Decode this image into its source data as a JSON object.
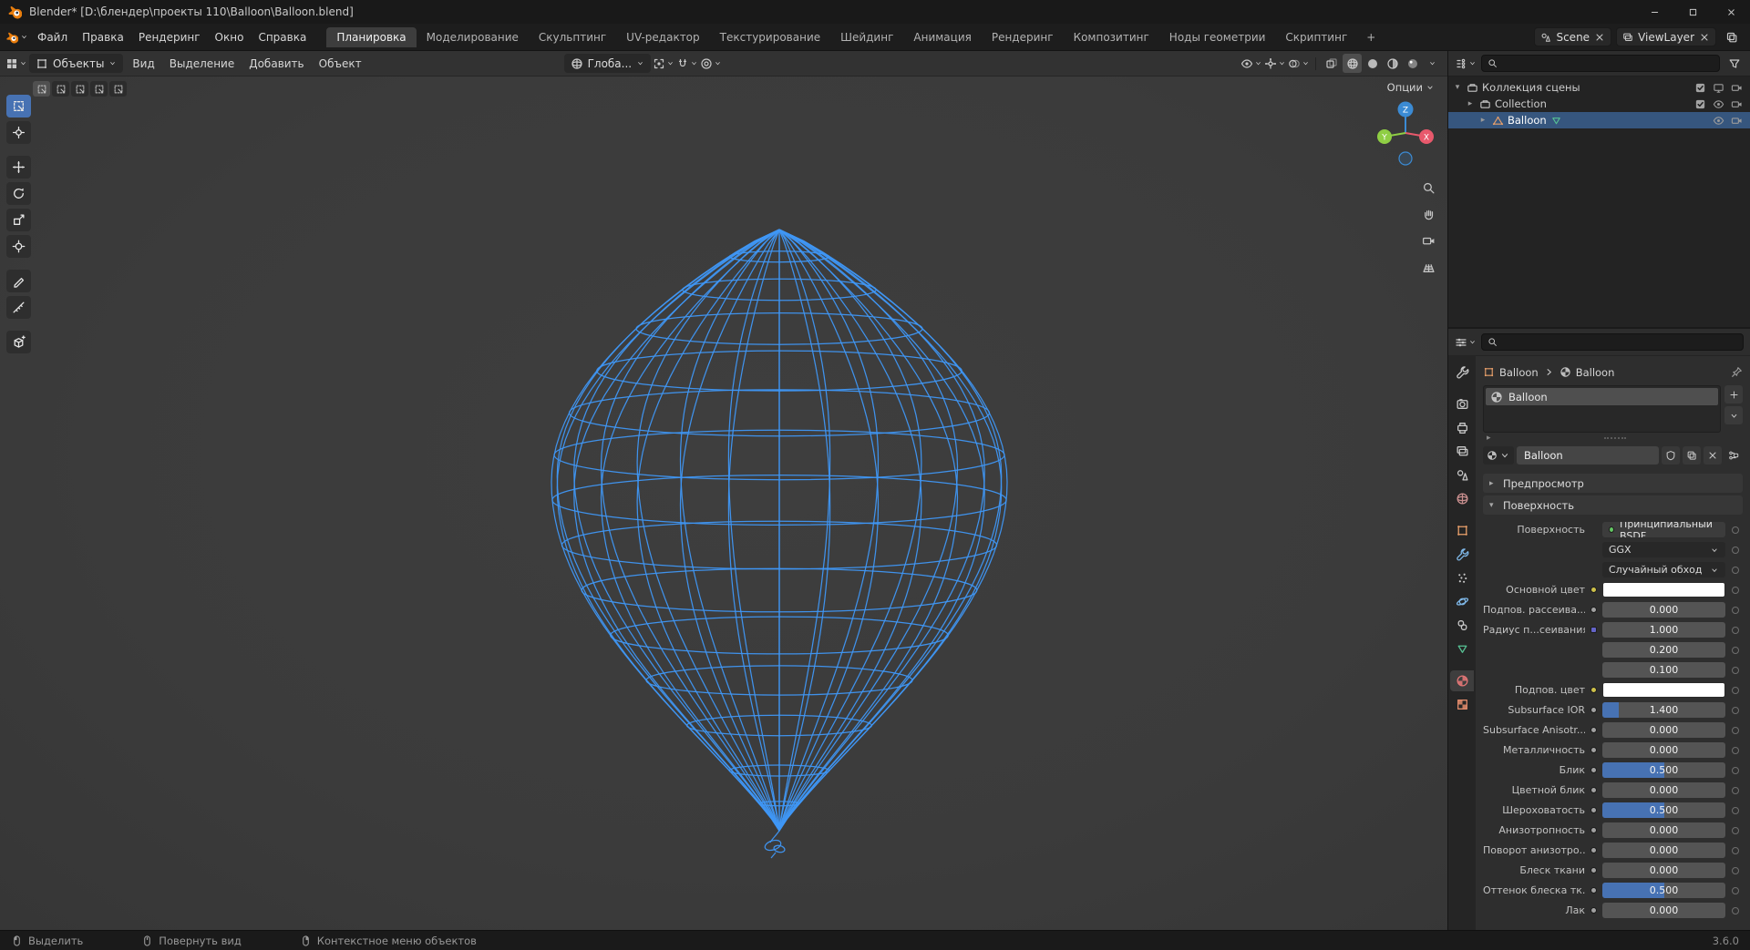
{
  "theme": {
    "accent": "#4772b3",
    "selection": "#36567e",
    "wireframe": "#3f97f5",
    "axis_x": "#e8596c",
    "axis_y": "#8fce44",
    "axis_z": "#3b8bd4",
    "socket_color": "#cdc04a",
    "socket_float": "#a1a1a1",
    "socket_vector": "#6464c8",
    "socket_shader": "#63c763"
  },
  "window": {
    "title": "Blender* [D:\\блендер\\проекты 110\\Balloon\\Balloon.blend]"
  },
  "menubar": {
    "menus": [
      "Файл",
      "Правка",
      "Рендеринг",
      "Окно",
      "Справка"
    ],
    "workspaces": [
      "Планировка",
      "Моделирование",
      "Скульптинг",
      "UV-редактор",
      "Текстурирование",
      "Шейдинг",
      "Анимация",
      "Рендеринг",
      "Композитинг",
      "Ноды геометрии",
      "Скриптинг"
    ],
    "active_workspace": "Планировка",
    "add_workspace_label": "+",
    "scene": {
      "label": "Scene"
    },
    "view_layer": {
      "label": "ViewLayer"
    }
  },
  "viewport_header": {
    "mode": "Объекты",
    "menus": [
      "Вид",
      "Выделение",
      "Добавить",
      "Объект"
    ],
    "orientation": "Глоба..."
  },
  "tool_settings": [
    {
      "id": "set",
      "active": true
    },
    {
      "id": "extend",
      "active": false
    },
    {
      "id": "subtract",
      "active": false
    },
    {
      "id": "invert",
      "active": false
    },
    {
      "id": "intersect",
      "active": false
    }
  ],
  "toolbar": [
    {
      "id": "select-box",
      "icon": "selectbox",
      "active": true
    },
    {
      "id": "cursor",
      "icon": "cursor3d",
      "active": false
    },
    {
      "id": "move",
      "icon": "move",
      "active": false
    },
    {
      "id": "rotate",
      "icon": "rotate",
      "active": false
    },
    {
      "id": "scale",
      "icon": "scale",
      "active": false
    },
    {
      "id": "transform",
      "icon": "transform",
      "active": false
    },
    {
      "id": "annotate",
      "icon": "annotate",
      "active": false
    },
    {
      "id": "measure",
      "icon": "measure",
      "active": false
    },
    {
      "id": "add-cube",
      "icon": "addcube",
      "active": false
    }
  ],
  "viewport": {
    "options_label": "Опции",
    "gizmo_axes": [
      "X",
      "Y",
      "Z"
    ]
  },
  "outliner": {
    "rows": [
      {
        "label": "Коллекция сцены",
        "icon": "collection",
        "indent": 0,
        "expand": "down",
        "selected": false,
        "right": [
          "checkbox",
          "screen",
          "camera"
        ]
      },
      {
        "label": "Collection",
        "icon": "collection",
        "indent": 1,
        "expand": "right",
        "selected": false,
        "right": [
          "checkbox",
          "eye",
          "camera"
        ]
      },
      {
        "label": "Balloon",
        "icon": "meshtri",
        "suffix_icon": "datatriangle",
        "indent": 2,
        "expand": "right",
        "selected": true,
        "right": [
          "eye",
          "camera"
        ]
      }
    ]
  },
  "properties": {
    "breadcrumb": {
      "object": "Balloon",
      "data": "Balloon"
    },
    "tabs": [
      {
        "id": "tool",
        "icon": "wrench",
        "color": "#c9c9c9",
        "active": false
      },
      {
        "id": "render",
        "icon": "render",
        "color": "#c9c9c9",
        "active": false
      },
      {
        "id": "output",
        "icon": "output",
        "color": "#c9c9c9",
        "active": false
      },
      {
        "id": "view-layer",
        "icon": "viewlayer",
        "color": "#c9c9c9",
        "active": false
      },
      {
        "id": "scene",
        "icon": "scene",
        "color": "#c9c9c9",
        "active": false
      },
      {
        "id": "world",
        "icon": "world",
        "color": "#c98f8f",
        "active": false
      },
      {
        "id": "object",
        "icon": "objsq",
        "color": "#e9a06b",
        "active": false
      },
      {
        "id": "modifiers",
        "icon": "wrench",
        "color": "#7fb8e8",
        "active": false
      },
      {
        "id": "particles",
        "icon": "particles",
        "color": "#c9c9c9",
        "active": false
      },
      {
        "id": "physics",
        "icon": "physics",
        "color": "#7fb8e8",
        "active": false
      },
      {
        "id": "constraints",
        "icon": "constraints",
        "color": "#c9c9c9",
        "active": false
      },
      {
        "id": "object-data",
        "icon": "datatriangle",
        "color": "#57c294",
        "active": false
      },
      {
        "id": "material",
        "icon": "matsphere",
        "color": "#e07575",
        "active": true
      },
      {
        "id": "texture",
        "icon": "texchecker",
        "color": "#e08b6b",
        "active": false
      }
    ],
    "slot_name": "Balloon",
    "material_name": "Balloon",
    "preview_section": "Предпросмотр",
    "surface_section": "Поверхность",
    "surface_label": "Поверхность",
    "surface_shader": "Принципиальный BSDF",
    "distribution": "GGX",
    "subsurface_method": "Случайный обход",
    "fields": [
      {
        "label": "Основной цвет",
        "type": "color",
        "socket": "color",
        "value": "#FFFFFF"
      },
      {
        "label": "Подпов. рассеива...",
        "type": "slider",
        "socket": "float",
        "value": "0.000",
        "fill": 0
      },
      {
        "label": "Радиус п...сеивания",
        "type": "value",
        "socket": "vector",
        "value": "1.000"
      },
      {
        "label": "",
        "type": "value",
        "socket": null,
        "value": "0.200"
      },
      {
        "label": "",
        "type": "value",
        "socket": null,
        "value": "0.100"
      },
      {
        "label": "Подпов. цвет",
        "type": "color",
        "socket": "color",
        "value": "#FFFFFF"
      },
      {
        "label": "Subsurface IOR",
        "type": "slider",
        "socket": "float",
        "value": "1.400",
        "fill": 0.13
      },
      {
        "label": "Subsurface Anisotr...",
        "type": "slider",
        "socket": "float",
        "value": "0.000",
        "fill": 0
      },
      {
        "label": "Металличность",
        "type": "slider",
        "socket": "float",
        "value": "0.000",
        "fill": 0
      },
      {
        "label": "Блик",
        "type": "slider",
        "socket": "float",
        "value": "0.500",
        "fill": 0.5
      },
      {
        "label": "Цветной блик",
        "type": "slider",
        "socket": "float",
        "value": "0.000",
        "fill": 0
      },
      {
        "label": "Шероховатость",
        "type": "slider",
        "socket": "float",
        "value": "0.500",
        "fill": 0.5
      },
      {
        "label": "Анизотропность",
        "type": "slider",
        "socket": "float",
        "value": "0.000",
        "fill": 0
      },
      {
        "label": "Поворот анизотро...",
        "type": "slider",
        "socket": "float",
        "value": "0.000",
        "fill": 0
      },
      {
        "label": "Блеск ткани",
        "type": "slider",
        "socket": "float",
        "value": "0.000",
        "fill": 0
      },
      {
        "label": "Оттенок блеска тк...",
        "type": "slider",
        "socket": "float",
        "value": "0.500",
        "fill": 0.5
      },
      {
        "label": "Лак",
        "type": "slider",
        "socket": "float",
        "value": "0.000",
        "fill": 0
      }
    ]
  },
  "statusbar": {
    "hints": [
      {
        "icon": "mouse-left",
        "label": "Выделить"
      },
      {
        "icon": "mouse-middle",
        "label": "Повернуть вид"
      },
      {
        "icon": "mouse-right",
        "label": "Контекстное меню объектов"
      }
    ],
    "version": "3.6.0"
  }
}
